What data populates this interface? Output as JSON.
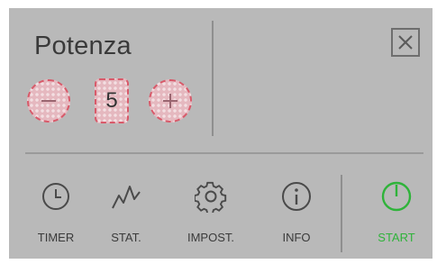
{
  "panel": {
    "title": "Potenza",
    "power_value": "5"
  },
  "icons": {
    "close": "close-icon",
    "minus": "minus-icon",
    "plus": "plus-icon",
    "timer": "clock-icon",
    "stats": "zigzag-chart-icon",
    "settings": "gear-icon",
    "info": "info-icon",
    "start": "power-icon"
  },
  "nav": {
    "timer_label": "TIMER",
    "stats_label": "STAT.",
    "settings_label": "IMPOST.",
    "info_label": "INFO",
    "start_label": "START"
  },
  "colors": {
    "panel_bg": "#b9b9b9",
    "control_fill": "#e5b8bf",
    "control_border": "#d85a6a",
    "start_accent": "#2fb33a",
    "text": "#3a3a3a"
  }
}
